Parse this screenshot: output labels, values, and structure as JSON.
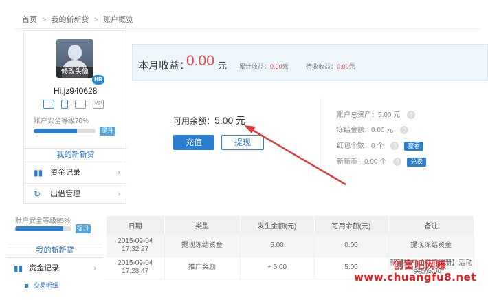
{
  "breadcrumb": {
    "home": "首页",
    "sep": ">",
    "level1": "我的新新贷",
    "level2": "账户概览"
  },
  "profile": {
    "avatar_caption": "修改头像",
    "badge": "HR",
    "username": "Hi,jz940628",
    "security_icons": [
      "id-card-icon",
      "phone-icon",
      "mail-icon",
      "vip-icon"
    ],
    "vip_text": "VIP",
    "security_level": "账户安全等级70%",
    "security_level_value": 70,
    "upgrade_label": "提升",
    "my_link": "我的新新贷"
  },
  "menu": [
    {
      "icon": "bar-chart-icon",
      "label": "资金记录",
      "chevron": "›"
    },
    {
      "icon": "refresh-icon",
      "label": "出借管理",
      "chevron": "›"
    }
  ],
  "summary": {
    "label": "本月收益：",
    "value": "0.00",
    "unit": "元",
    "total_label": "累计收益：",
    "total_value": "0.00",
    "total_unit": "元",
    "pending_label": "待收收益：",
    "pending_value": "0.00",
    "pending_unit": "元"
  },
  "balance": {
    "label": "可用余额：",
    "value": "5.00 元",
    "charge": "充值",
    "withdraw": "提现"
  },
  "right_info": [
    {
      "label": "账户总资产：",
      "value": "5.00 元",
      "action": ""
    },
    {
      "label": "冻结金额：",
      "value": "0.00 元",
      "action": ""
    },
    {
      "label": "红包个数：",
      "value": "0 个",
      "action": "查看"
    },
    {
      "label": "新新币：",
      "value": "0.00 个",
      "action": "兑换"
    }
  ],
  "qmark": "?",
  "bottom": {
    "security_level": "账户安全等级85%",
    "security_level_value": 85,
    "upgrade_label": "提升",
    "my_link": "我的新新贷",
    "menu_label": "资金记录",
    "menu_chevron": "›",
    "sub_link": "交易明细"
  },
  "table": {
    "headers": [
      "日期",
      "类型",
      "发生金额(元)",
      "可用余额(元)",
      "备注"
    ],
    "rows": [
      {
        "date": "2015-09-04",
        "time": "17:32:27",
        "type": "提现冻结资金",
        "amount": "5.00",
        "balance": "0.00",
        "note1": "提现冻结资金",
        "note2": ""
      },
      {
        "date": "2015-09-04",
        "time": "17:28:47",
        "type": "推广奖励",
        "amount": "+ 5.00",
        "balance": "5.00",
        "note1": "新新推广【邀请注册】活动",
        "note2": "奖励5.00！"
      }
    ]
  },
  "watermark": {
    "text": "www.chuangfu8.net",
    "logo": "创富吧网赚"
  }
}
